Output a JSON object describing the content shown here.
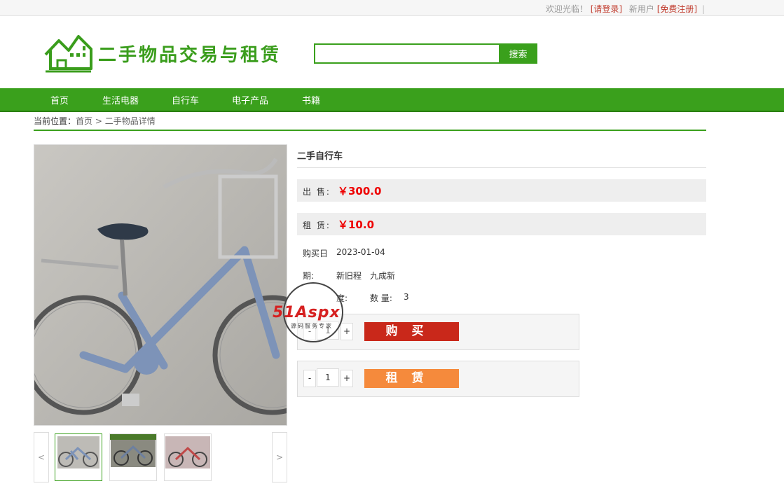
{
  "topbar": {
    "welcome": "欢迎光临！",
    "login": "[请登录]",
    "new_user": "新用户",
    "register": "[免费注册]",
    "sep": "|"
  },
  "brand": {
    "title": "二手物品交易与租赁"
  },
  "search": {
    "value": "",
    "button": "搜索"
  },
  "nav": [
    "首页",
    "生活电器",
    "自行车",
    "电子产品",
    "书籍"
  ],
  "breadcrumb": {
    "prefix": "当前位置：",
    "home": "首页",
    "arrow": ">",
    "current": "二手物品详情"
  },
  "product": {
    "name": "二手自行车",
    "sale_label": "出  售:",
    "sale_price": "￥300.0",
    "rent_label": "租  赁:",
    "rent_price": "￥10.0",
    "date_label": "购买日",
    "date_value": "2023-01-04",
    "cond_label": "期:",
    "cond_label2": "新旧程",
    "cond_value": "九成新",
    "degree_label": "度:",
    "qty_label": "数  量:",
    "qty_value": "3"
  },
  "buy": {
    "minus": "-",
    "qty": "1",
    "plus": "+",
    "label": "购买"
  },
  "rent": {
    "minus": "-",
    "qty": "1",
    "plus": "+",
    "label": "租赁"
  },
  "thumbs": {
    "prev": "<",
    "next": ">"
  },
  "watermark": {
    "brand": "51Aspx",
    "sub": "源码服务专家"
  },
  "colors": {
    "accent": "#3aa01c",
    "price": "#e00000",
    "buy": "#c9281a",
    "rent": "#f58a3c"
  }
}
